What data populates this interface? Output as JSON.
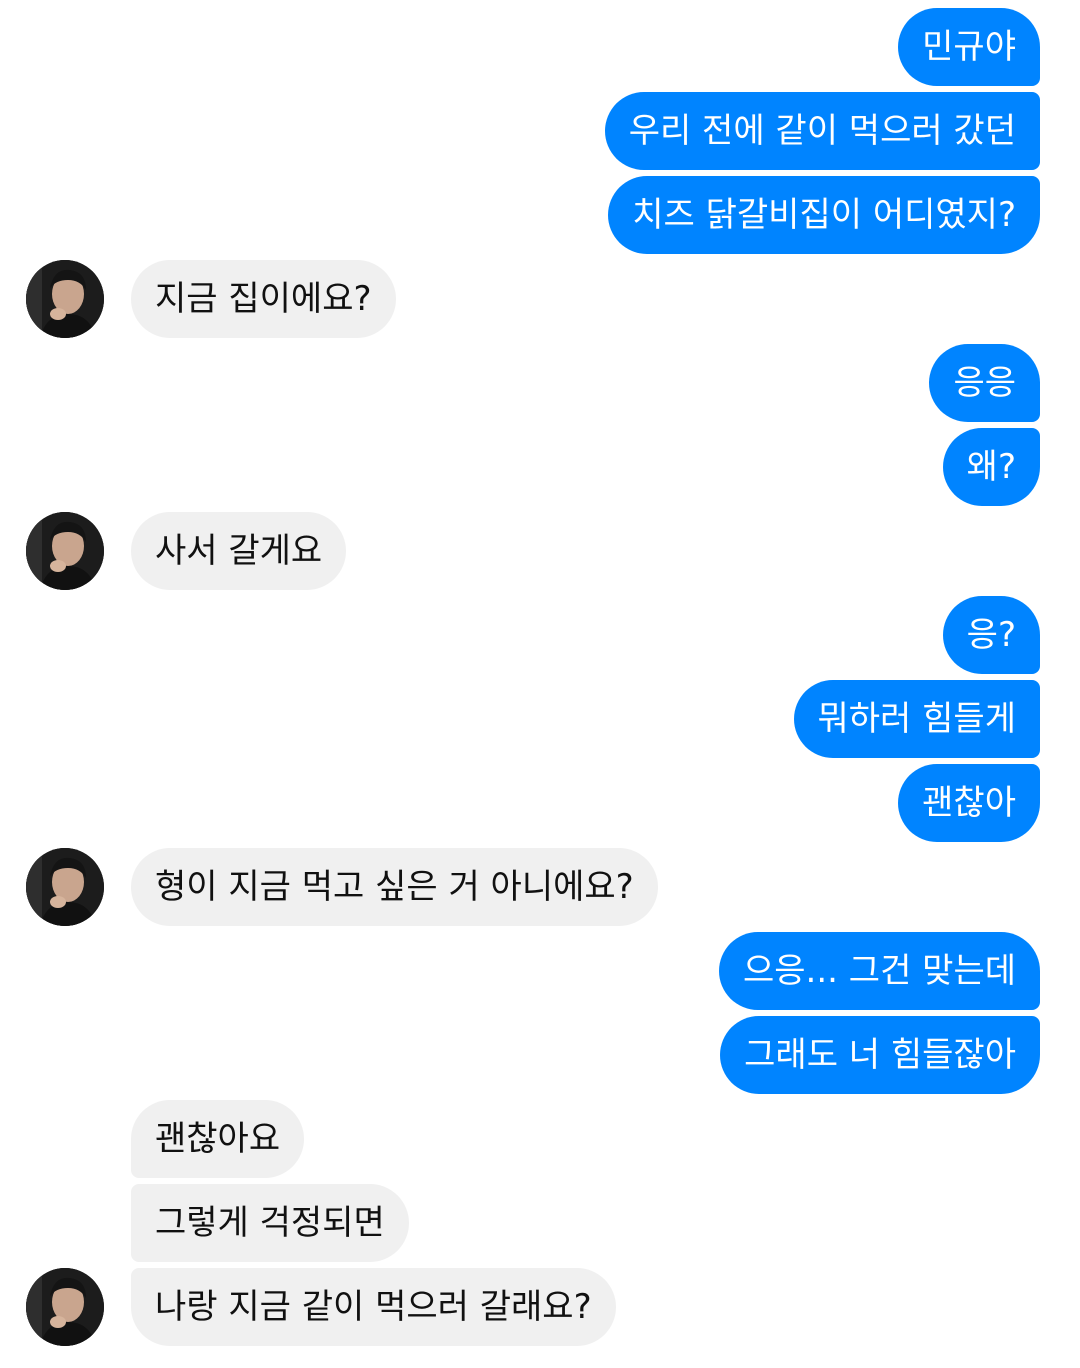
{
  "conversation": {
    "messages": [
      {
        "side": "out",
        "text": "민규야"
      },
      {
        "side": "out",
        "text": "우리 전에 같이 먹으러 갔던"
      },
      {
        "side": "out",
        "text": "치즈 닭갈비집이 어디였지?"
      },
      {
        "side": "in",
        "text": "지금 집이에요?"
      },
      {
        "side": "out",
        "text": "응응"
      },
      {
        "side": "out",
        "text": "왜?"
      },
      {
        "side": "in",
        "text": "사서 갈게요"
      },
      {
        "side": "out",
        "text": "응?"
      },
      {
        "side": "out",
        "text": "뭐하러 힘들게"
      },
      {
        "side": "out",
        "text": "괜찮아"
      },
      {
        "side": "in",
        "text": "형이 지금 먹고 싶은 거 아니에요?"
      },
      {
        "side": "out",
        "text": "으응... 그건 맞는데"
      },
      {
        "side": "out",
        "text": "그래도 너 힘들잖아"
      },
      {
        "side": "in",
        "text": "괜찮아요"
      },
      {
        "side": "in",
        "text": "그렇게 걱정되면"
      },
      {
        "side": "in",
        "text": "나랑 지금 같이 먹으러 갈래요?"
      }
    ]
  },
  "colors": {
    "outgoing_bubble": "#0084ff",
    "outgoing_text": "#ffffff",
    "incoming_bubble": "#f0f0f0",
    "incoming_text": "#111111"
  },
  "icons": {
    "contact_avatar": "avatar-photo"
  }
}
